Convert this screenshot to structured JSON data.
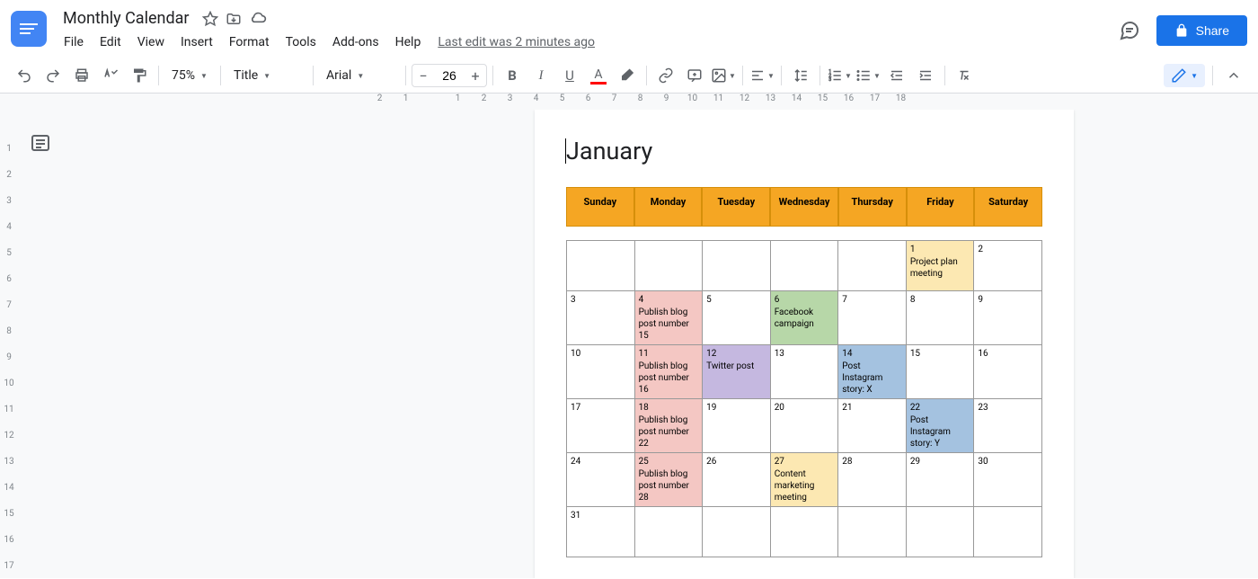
{
  "doc": {
    "title": "Monthly Calendar"
  },
  "menus": [
    "File",
    "Edit",
    "View",
    "Insert",
    "Format",
    "Tools",
    "Add-ons",
    "Help"
  ],
  "last_edit": "Last edit was 2 minutes ago",
  "share": "Share",
  "toolbar": {
    "zoom": "75%",
    "style": "Title",
    "font": "Arial",
    "size": "26"
  },
  "ruler": {
    "marks": [
      "2",
      "1",
      "",
      "1",
      "2",
      "3",
      "4",
      "5",
      "6",
      "7",
      "8",
      "9",
      "10",
      "11",
      "12",
      "13",
      "14",
      "15",
      "16",
      "17",
      "18"
    ]
  },
  "vruler": {
    "marks": [
      "",
      "1",
      "2",
      "3",
      "4",
      "5",
      "6",
      "7",
      "8",
      "9",
      "10",
      "11",
      "12",
      "13",
      "14",
      "15",
      "16",
      "17"
    ]
  },
  "month": "January",
  "days": [
    "Sunday",
    "Monday",
    "Tuesday",
    "Wednesday",
    "Thursday",
    "Friday",
    "Saturday"
  ],
  "calendar": [
    [
      {
        "n": "",
        "ev": "",
        "bg": ""
      },
      {
        "n": "",
        "ev": "",
        "bg": ""
      },
      {
        "n": "",
        "ev": "",
        "bg": ""
      },
      {
        "n": "",
        "ev": "",
        "bg": ""
      },
      {
        "n": "",
        "ev": "",
        "bg": ""
      },
      {
        "n": "1",
        "ev": "Project plan meeting",
        "bg": "bg-yellow"
      },
      {
        "n": "2",
        "ev": "",
        "bg": ""
      }
    ],
    [
      {
        "n": "3",
        "ev": "",
        "bg": ""
      },
      {
        "n": "4",
        "ev": "Publish blog post number 15",
        "bg": "bg-pink"
      },
      {
        "n": "5",
        "ev": "",
        "bg": ""
      },
      {
        "n": "6",
        "ev": "Facebook campaign",
        "bg": "bg-green"
      },
      {
        "n": "7",
        "ev": "",
        "bg": ""
      },
      {
        "n": "8",
        "ev": "",
        "bg": ""
      },
      {
        "n": "9",
        "ev": "",
        "bg": ""
      }
    ],
    [
      {
        "n": "10",
        "ev": "",
        "bg": ""
      },
      {
        "n": "11",
        "ev": "Publish blog post number 16",
        "bg": "bg-pink"
      },
      {
        "n": "12",
        "ev": "Twitter post",
        "bg": "bg-purple"
      },
      {
        "n": "13",
        "ev": "",
        "bg": ""
      },
      {
        "n": "14",
        "ev": "Post Instagram story: X",
        "bg": "bg-blue"
      },
      {
        "n": "15",
        "ev": "",
        "bg": ""
      },
      {
        "n": "16",
        "ev": "",
        "bg": ""
      }
    ],
    [
      {
        "n": "17",
        "ev": "",
        "bg": ""
      },
      {
        "n": "18",
        "ev": "Publish blog post number 22",
        "bg": "bg-pink"
      },
      {
        "n": "19",
        "ev": "",
        "bg": ""
      },
      {
        "n": "20",
        "ev": "",
        "bg": ""
      },
      {
        "n": "21",
        "ev": "",
        "bg": ""
      },
      {
        "n": "22",
        "ev": "Post Instagram story: Y",
        "bg": "bg-blue"
      },
      {
        "n": "23",
        "ev": "",
        "bg": ""
      }
    ],
    [
      {
        "n": "24",
        "ev": "",
        "bg": ""
      },
      {
        "n": "25",
        "ev": "Publish blog post number 28",
        "bg": "bg-pink"
      },
      {
        "n": "26",
        "ev": "",
        "bg": ""
      },
      {
        "n": "27",
        "ev": "Content marketing meeting",
        "bg": "bg-yellow"
      },
      {
        "n": "28",
        "ev": "",
        "bg": ""
      },
      {
        "n": "29",
        "ev": "",
        "bg": ""
      },
      {
        "n": "30",
        "ev": "",
        "bg": ""
      }
    ],
    [
      {
        "n": "31",
        "ev": "",
        "bg": ""
      },
      {
        "n": "",
        "ev": "",
        "bg": ""
      },
      {
        "n": "",
        "ev": "",
        "bg": ""
      },
      {
        "n": "",
        "ev": "",
        "bg": ""
      },
      {
        "n": "",
        "ev": "",
        "bg": ""
      },
      {
        "n": "",
        "ev": "",
        "bg": ""
      },
      {
        "n": "",
        "ev": "",
        "bg": ""
      }
    ]
  ]
}
